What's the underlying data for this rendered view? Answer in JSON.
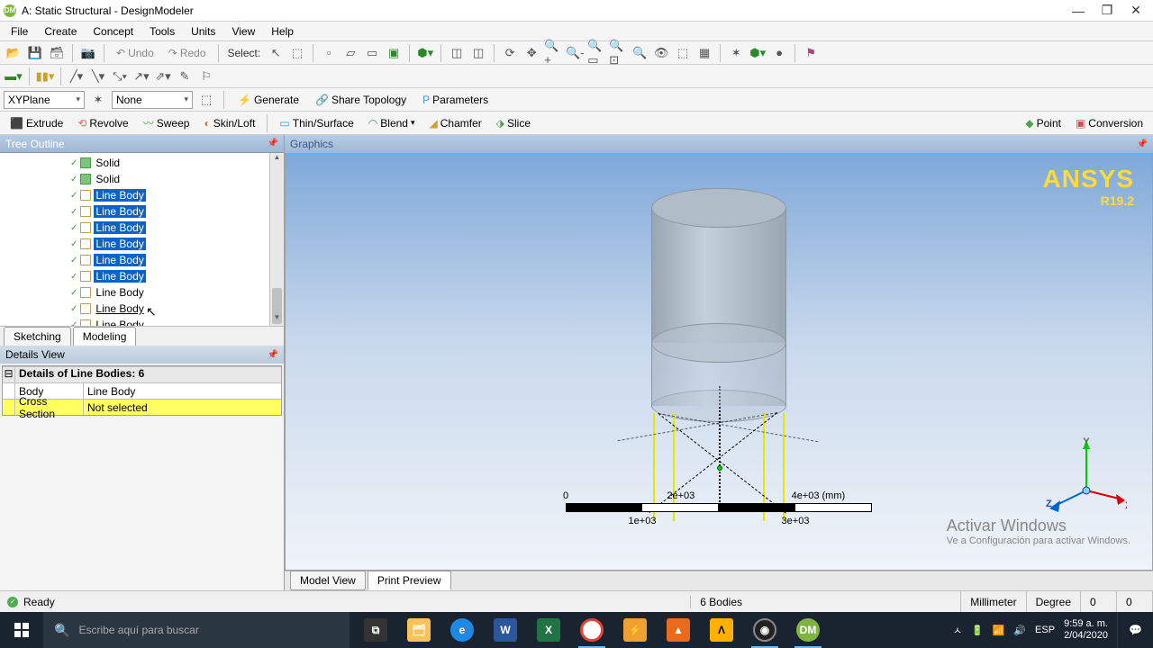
{
  "window": {
    "title": "A: Static Structural - DesignModeler",
    "minimize": "—",
    "maximize": "❐",
    "close": "✕"
  },
  "menu": [
    "File",
    "Create",
    "Concept",
    "Tools",
    "Units",
    "View",
    "Help"
  ],
  "toolbar1": {
    "undo": "Undo",
    "redo": "Redo",
    "select": "Select:"
  },
  "plane_row": {
    "plane": "XYPlane",
    "sketch": "None",
    "generate": "Generate",
    "share_topology": "Share Topology",
    "parameters": "Parameters"
  },
  "features": {
    "extrude": "Extrude",
    "revolve": "Revolve",
    "sweep": "Sweep",
    "skinloft": "Skin/Loft",
    "thin": "Thin/Surface",
    "blend": "Blend",
    "chamfer": "Chamfer",
    "slice": "Slice",
    "point": "Point",
    "conversion": "Conversion"
  },
  "tree": {
    "header": "Tree Outline",
    "items": [
      {
        "label": "Solid",
        "type": "solid",
        "selected": false
      },
      {
        "label": "Solid",
        "type": "solid",
        "selected": false
      },
      {
        "label": "Line Body",
        "type": "line",
        "selected": true
      },
      {
        "label": "Line Body",
        "type": "line",
        "selected": true
      },
      {
        "label": "Line Body",
        "type": "line",
        "selected": true
      },
      {
        "label": "Line Body",
        "type": "line",
        "selected": true
      },
      {
        "label": "Line Body",
        "type": "line",
        "selected": true
      },
      {
        "label": "Line Body",
        "type": "line",
        "selected": true
      },
      {
        "label": "Line Body",
        "type": "line",
        "selected": false
      },
      {
        "label": "Line Body",
        "type": "line",
        "selected": false,
        "underline": true
      },
      {
        "label": "Line Body",
        "type": "line",
        "selected": false
      }
    ],
    "tabs": {
      "sketching": "Sketching",
      "modeling": "Modeling"
    }
  },
  "details": {
    "header": "Details View",
    "title": "Details of Line Bodies: 6",
    "rows": [
      {
        "k": "Body",
        "v": "Line Body",
        "yellow": false
      },
      {
        "k": "Cross Section",
        "v": "Not selected",
        "yellow": true
      }
    ]
  },
  "graphics": {
    "header": "Graphics",
    "brand": {
      "l1": "ANSYS",
      "l2": "R19.2"
    },
    "ruler": {
      "ticks_top": [
        "0",
        "2e+03",
        "4e+03 (mm)"
      ],
      "ticks_bot": [
        "1e+03",
        "3e+03"
      ]
    },
    "triad": {
      "x": "X",
      "y": "Y",
      "z": "Z"
    },
    "watermark": {
      "l1": "Activar Windows",
      "l2": "Ve a Configuración para activar Windows."
    },
    "tabs": {
      "model": "Model View",
      "print": "Print Preview"
    }
  },
  "status": {
    "ready": "Ready",
    "selection": "6 Bodies",
    "unit1": "Millimeter",
    "unit2": "Degree",
    "v1": "0",
    "v2": "0"
  },
  "taskbar": {
    "search_placeholder": "Escribe aquí para buscar",
    "tray": {
      "up": "ㅅ",
      "lang": "ESP",
      "time": "9:59 a. m.",
      "date": "2/04/2020"
    }
  }
}
